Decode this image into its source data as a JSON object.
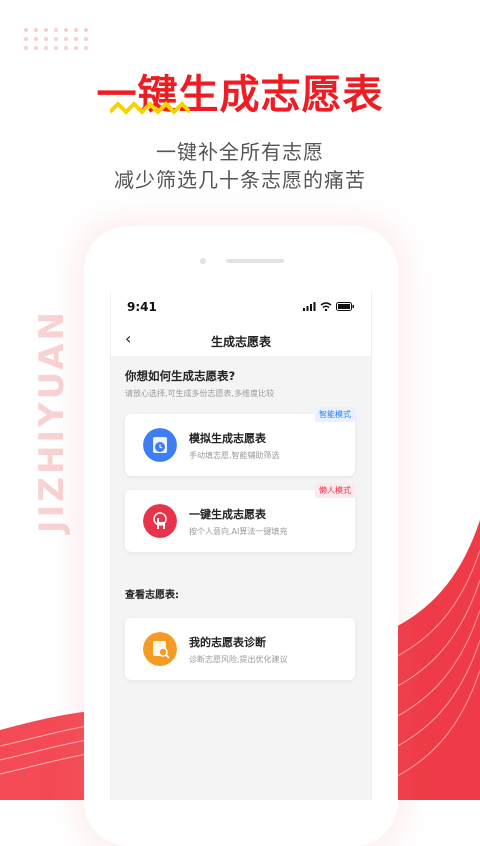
{
  "headline": "一键生成志愿表",
  "subline1": "一键补全所有志愿",
  "subline2": "减少筛选几十条志愿的痛苦",
  "vertical_text": "JIZHIYUAN",
  "colors": {
    "accent_red": "#ee1d23",
    "zigzag_yellow": "#f7d400",
    "blue_icon": "#3d7ef4",
    "red_icon": "#e8334a",
    "orange_icon": "#f59a22"
  },
  "phone": {
    "status": {
      "time": "9:41",
      "icons": [
        "signal-icon",
        "wifi-icon",
        "battery-icon"
      ]
    },
    "nav": {
      "back_glyph": "‹",
      "title": "生成志愿表"
    },
    "question": "你想如何生成志愿表?",
    "hint": "请放心选择,可生成多份志愿表,多维度比较",
    "cards": [
      {
        "title": "模拟生成志愿表",
        "desc": "手动填志愿,智能辅助筛选",
        "badge": "智能模式",
        "icon": "clock-icon"
      },
      {
        "title": "一键生成志愿表",
        "desc": "按个人意向,AI算法一键填充",
        "badge": "懒人模式",
        "icon": "tap-icon"
      }
    ],
    "section2": "查看志愿表:",
    "diagnose": {
      "title": "我的志愿表诊断",
      "desc": "诊断志愿风险,提出优化建议",
      "icon": "search-doc-icon"
    }
  }
}
